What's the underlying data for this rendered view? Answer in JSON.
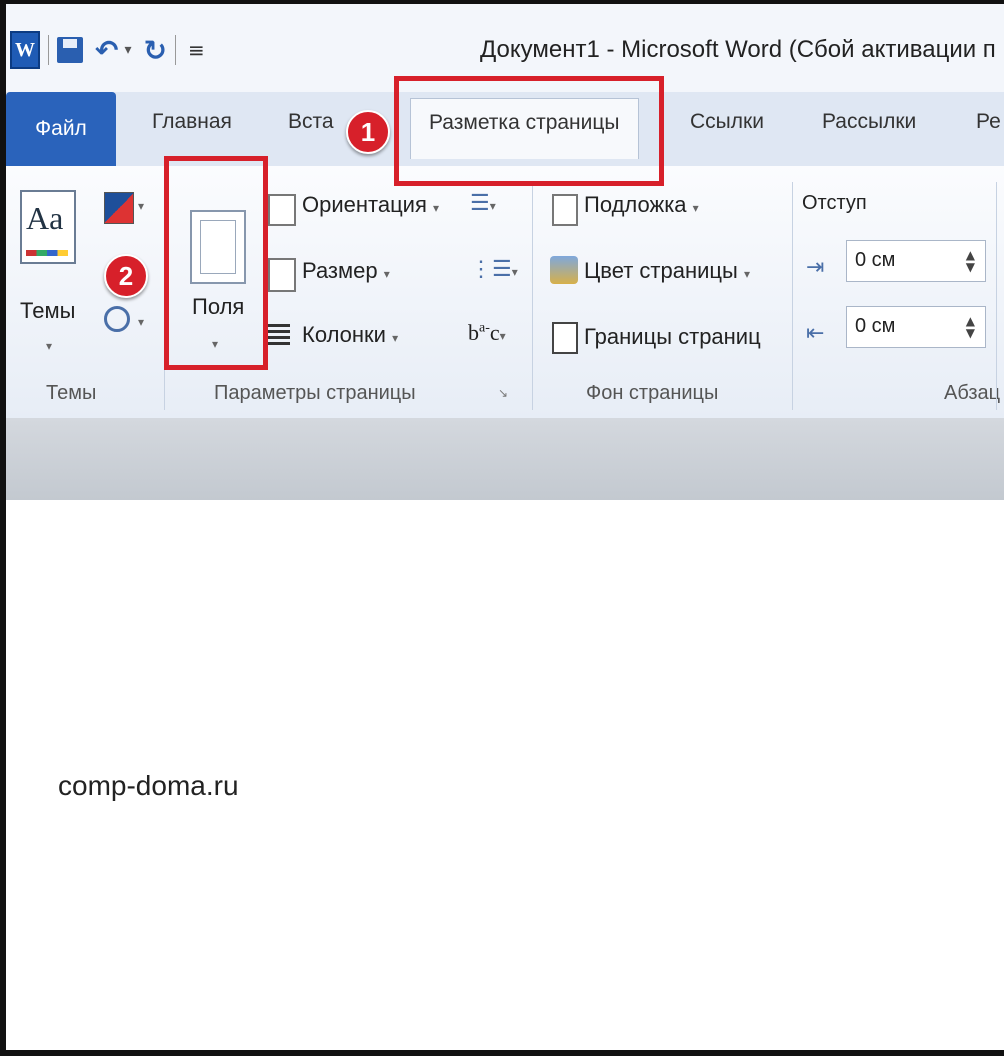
{
  "window": {
    "title": "Документ1  -  Microsoft Word (Сбой активации п"
  },
  "qat": {
    "app_icon_letter": "W"
  },
  "tabs": [
    {
      "label": "Файл"
    },
    {
      "label": "Главная"
    },
    {
      "label": "Вста"
    },
    {
      "label": "Разметка страницы"
    },
    {
      "label": "Ссылки"
    },
    {
      "label": "Рассылки"
    },
    {
      "label": "Ре"
    }
  ],
  "ribbon": {
    "themes": {
      "button_label": "Темы",
      "group_label": "Темы"
    },
    "page_setup": {
      "margins_label": "Поля",
      "orientation_label": "Ориентация",
      "size_label": "Размер",
      "columns_label": "Колонки",
      "group_label": "Параметры страницы"
    },
    "page_background": {
      "watermark_label": "Подложка",
      "page_color_label": "Цвет страницы",
      "page_borders_label": "Границы страниц",
      "group_label": "Фон страницы"
    },
    "paragraph": {
      "indent_label": "Отступ",
      "indent_left_value": "0 см",
      "indent_right_value": "0 см",
      "group_label": "Абзац"
    }
  },
  "annotations": {
    "badge_1": "1",
    "badge_2": "2",
    "highlight_color": "#d7202a"
  },
  "document": {
    "text": "comp-doma.ru"
  }
}
